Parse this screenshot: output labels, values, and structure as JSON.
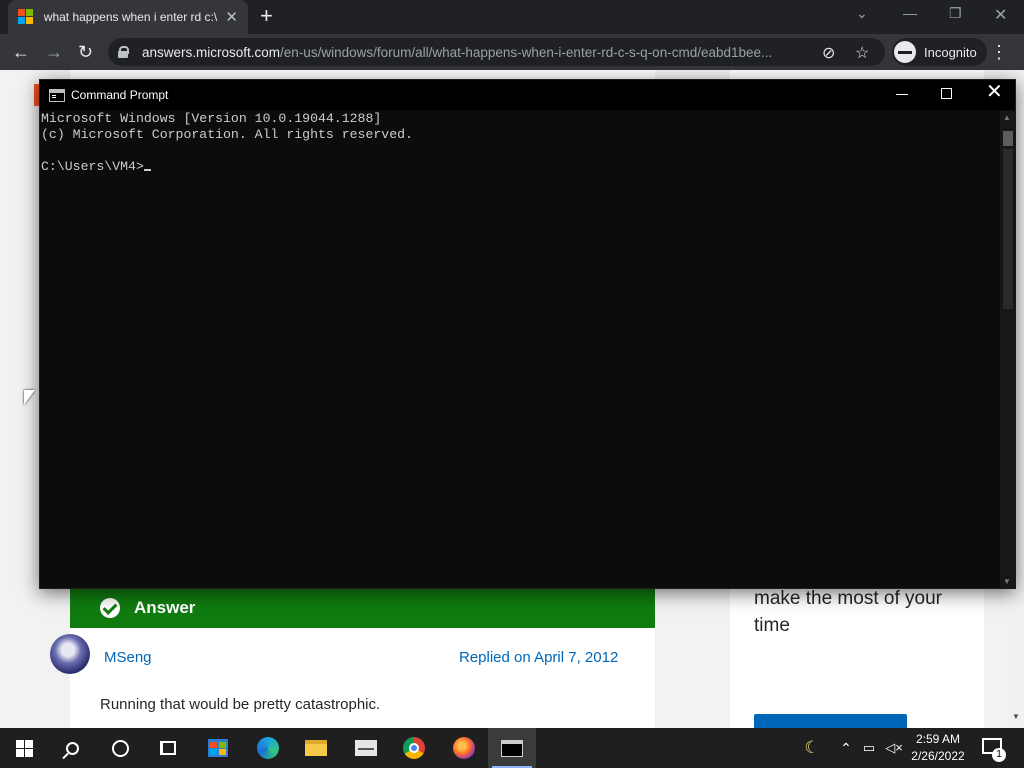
{
  "browser": {
    "tab_title": "what happens when i enter rd c:\\",
    "url_host": "answers.microsoft.com",
    "url_path": "/en-us/windows/forum/all/what-happens-when-i-enter-rd-c-s-q-on-cmd/eabd1bee...",
    "incognito_label": "Incognito",
    "icons": [
      "close-tab-icon",
      "new-tab-icon",
      "back-icon",
      "forward-icon",
      "reload-icon",
      "lock-icon",
      "eye-off-icon",
      "star-icon",
      "incognito-icon",
      "more-icon"
    ]
  },
  "page": {
    "answer_label": "Answer",
    "author": "MSeng",
    "replied": "Replied on April 7, 2012",
    "body": "Running that would be pretty catastrophic.",
    "side_text": "make the most of your time"
  },
  "cmd": {
    "title": "Command Prompt",
    "line1": "Microsoft Windows [Version 10.0.19044.1288]",
    "line2": "(c) Microsoft Corporation. All rights reserved.",
    "prompt": "C:\\Users\\VM4>"
  },
  "taskbar": {
    "apps": [
      "start",
      "search",
      "cortana",
      "task-view",
      "store",
      "edge",
      "file-explorer",
      "mail",
      "chrome",
      "firefox",
      "command-prompt"
    ],
    "time": "2:59 AM",
    "date": "2/26/2022",
    "notification_count": "1"
  },
  "colors": {
    "answer_green": "#107c10",
    "link_blue": "#0067b8",
    "console_bg": "#0c0c0c",
    "chrome_dark": "#202124"
  }
}
